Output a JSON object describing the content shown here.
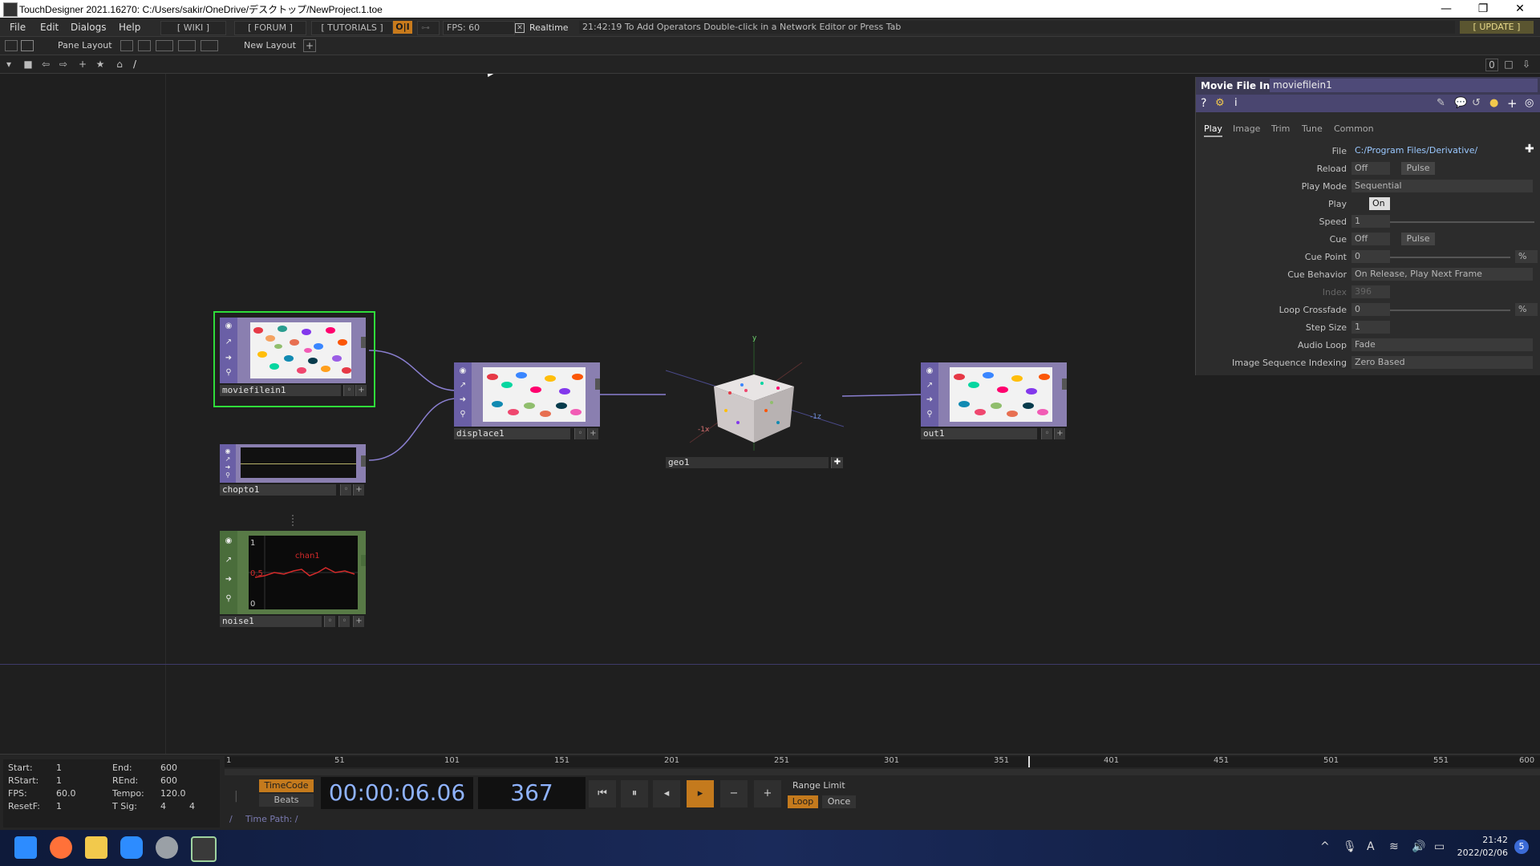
{
  "window": {
    "title": "TouchDesigner 2021.16270: C:/Users/sakir/OneDrive/デスクトップ/NewProject.1.toe",
    "min": "—",
    "max": "❐",
    "close": "✕"
  },
  "menubar": {
    "items": [
      "File",
      "Edit",
      "Dialogs",
      "Help"
    ],
    "wiki": "[ WIKI ]",
    "forum": "[ FORUM ]",
    "tutorials": "[ TUTORIALS ]",
    "oii": "O|I",
    "fps": "FPS: 60",
    "realtime": "Realtime",
    "status": "21:42:19 To Add Operators Double-click in a Network Editor or Press Tab",
    "update": "[ UPDATE ]"
  },
  "layoutbar": {
    "pane_layout": "Pane Layout",
    "new_layout": "New Layout"
  },
  "pathbar": {
    "path": "/",
    "right_value": "0"
  },
  "nodes": {
    "moviefilein1": "moviefilein1",
    "displace1": "displace1",
    "chopto1": "chopto1",
    "noise1": "noise1",
    "geo1": "geo1",
    "out1": "out1",
    "noise_chan": "chan1",
    "noise_y1": "1",
    "noise_y05": "0.5",
    "noise_y0": "0",
    "axis_y": "y",
    "axis_x": "-1x",
    "axis_z": "-1z"
  },
  "params": {
    "op_type": "Movie File In",
    "op_name": "moviefilein1",
    "tabs": [
      "Play",
      "Image",
      "Trim",
      "Tune",
      "Common"
    ],
    "rows": {
      "file_label": "File",
      "file_value": "C:/Program Files/Derivative/",
      "reload_label": "Reload",
      "reload_value": "Off",
      "reload_pulse": "Pulse",
      "playmode_label": "Play Mode",
      "playmode_value": "Sequential",
      "play_label": "Play",
      "play_value": "On",
      "speed_label": "Speed",
      "speed_value": "1",
      "cue_label": "Cue",
      "cue_value": "Off",
      "cue_pulse": "Pulse",
      "cuepoint_label": "Cue Point",
      "cuepoint_value": "0",
      "cuepoint_unit": "%",
      "cuebehavior_label": "Cue Behavior",
      "cuebehavior_value": "On Release, Play Next Frame",
      "index_label": "Index",
      "index_value": "396",
      "loopcrossfade_label": "Loop Crossfade",
      "loopcrossfade_value": "0",
      "loopcrossfade_unit": "%",
      "stepsize_label": "Step Size",
      "stepsize_value": "1",
      "audioloop_label": "Audio Loop",
      "audioloop_value": "Fade",
      "imageseq_label": "Image Sequence Indexing",
      "imageseq_value": "Zero Based"
    }
  },
  "timeline": {
    "stats": {
      "start_l": "Start:",
      "start_v": "1",
      "end_l": "End:",
      "end_v": "600",
      "rstart_l": "RStart:",
      "rstart_v": "1",
      "rend_l": "REnd:",
      "rend_v": "600",
      "fps_l": "FPS:",
      "fps_v": "60.0",
      "tempo_l": "Tempo:",
      "tempo_v": "120.0",
      "resetf_l": "ResetF:",
      "resetf_v": "1",
      "tsig_l": "T Sig:",
      "tsig_v1": "4",
      "tsig_v2": "4"
    },
    "ticks": [
      "1",
      "51",
      "101",
      "151",
      "201",
      "251",
      "301",
      "351",
      "401",
      "451",
      "501",
      "551",
      "600"
    ],
    "current_frame_fraction": 0.611,
    "timecode_btn": "TimeCode",
    "beats_btn": "Beats",
    "time": "00:00:06.06",
    "frame": "367",
    "range_limit": "Range Limit",
    "loop": "Loop",
    "once": "Once",
    "time_path": "Time Path: /"
  },
  "taskbar": {
    "time": "21:42",
    "date": "2022/02/06",
    "ime": "A",
    "notif": "5"
  }
}
